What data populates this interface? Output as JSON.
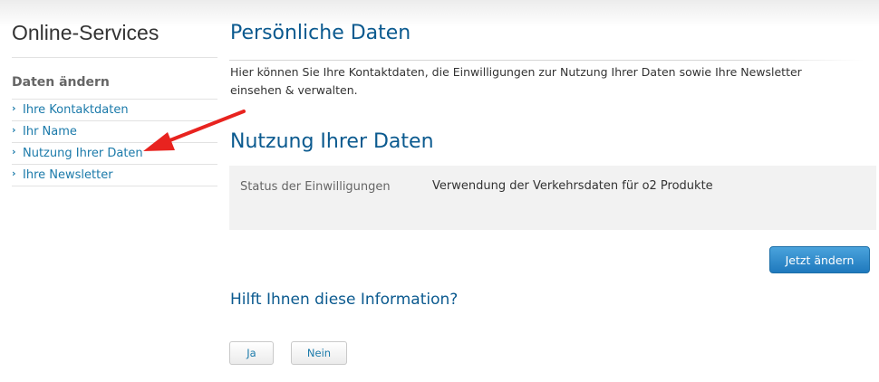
{
  "sidebar": {
    "title": "Online-Services",
    "subtitle": "Daten ändern",
    "items": [
      {
        "label": "Ihre Kontaktdaten"
      },
      {
        "label": "Ihr Name"
      },
      {
        "label": "Nutzung Ihrer Daten"
      },
      {
        "label": "Ihre Newsletter"
      }
    ],
    "item_icon": "chevron-right-icon"
  },
  "annotation": {
    "icon": "red-arrow-icon",
    "color": "#e8231f"
  },
  "main": {
    "page_title": "Persönliche Daten",
    "intro": "Hier können Sie Ihre Kontaktdaten, die Einwilligungen zur Nutzung Ihrer Daten sowie Ihre Newsletter einsehen & verwalten.",
    "section_title": "Nutzung Ihrer Daten",
    "status_label": "Status der Einwilligungen",
    "status_value": "Verwendung der Verkehrsdaten für o2 Produkte",
    "change_button": "Jetzt ändern",
    "feedback_question": "Hilft Ihnen diese Information?",
    "yes_button": "Ja",
    "no_button": "Nein"
  },
  "colors": {
    "heading": "#0b5a8f",
    "link": "#1b7aaa",
    "primary_button": "#2b8bd0",
    "status_background": "#f2f2f2"
  }
}
